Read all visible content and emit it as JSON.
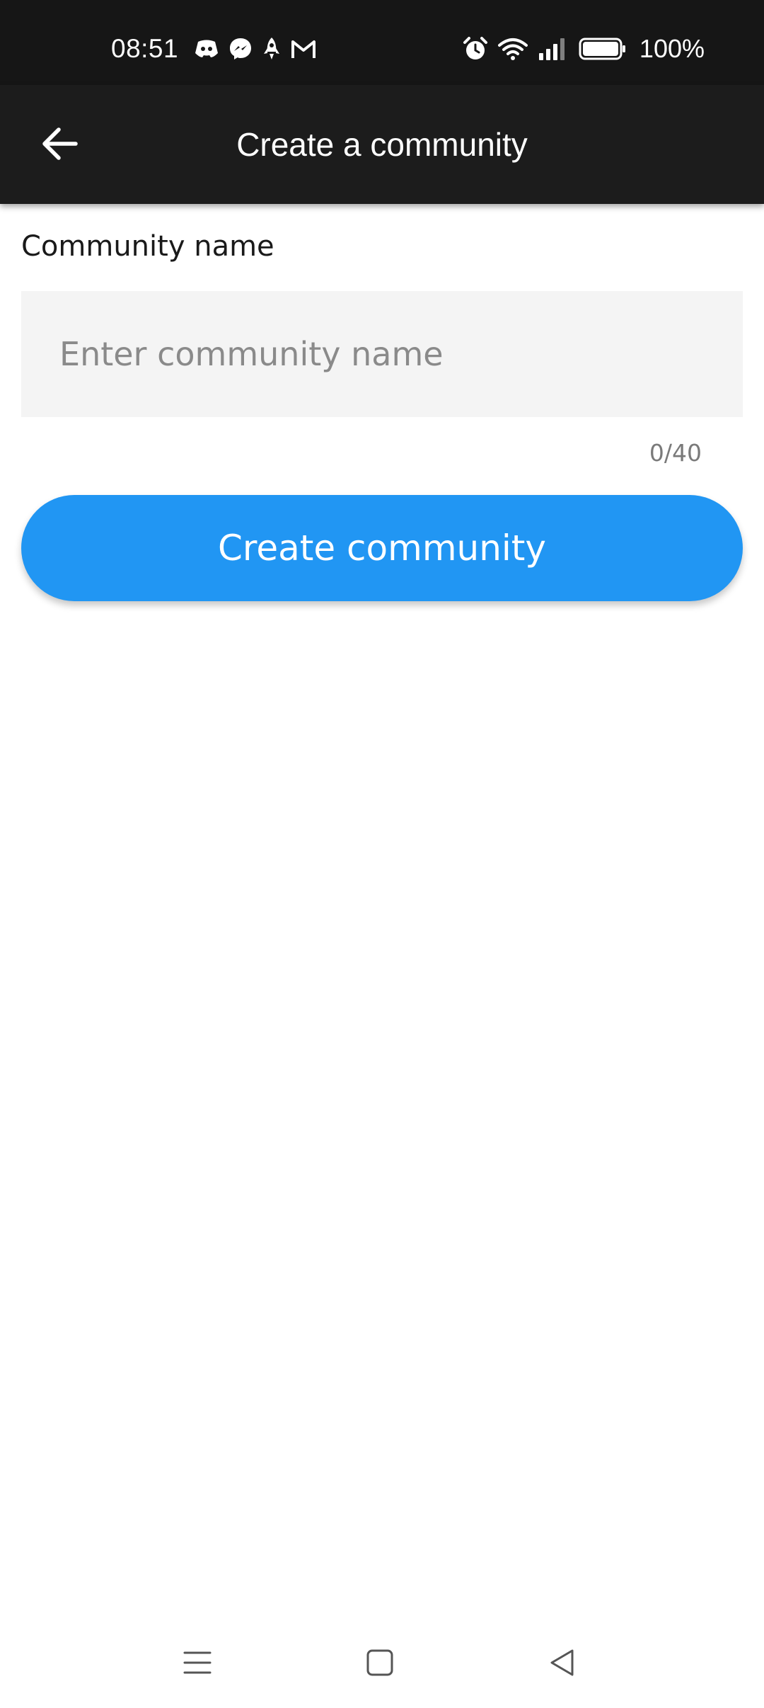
{
  "status_bar": {
    "time": "08:51",
    "battery": "100%",
    "notification_icons": [
      "discord-icon",
      "messenger-icon",
      "rocket-icon",
      "gmail-icon"
    ],
    "system_icons": [
      "alarm-icon",
      "wifi-icon",
      "signal-icon",
      "battery-icon"
    ]
  },
  "app_bar": {
    "title": "Create a community",
    "back_icon": "arrow-left-icon"
  },
  "form": {
    "label": "Community name",
    "input_value": "",
    "input_placeholder": "Enter community name",
    "counter": "0/40",
    "submit_label": "Create community"
  },
  "nav_bar": {
    "icons": [
      "menu-icon",
      "home-square-icon",
      "back-triangle-icon"
    ]
  },
  "colors": {
    "status_bar_bg": "#161616",
    "app_bar_bg": "#1c1c1c",
    "accent": "#2196f3",
    "input_bg": "#f4f4f4"
  }
}
